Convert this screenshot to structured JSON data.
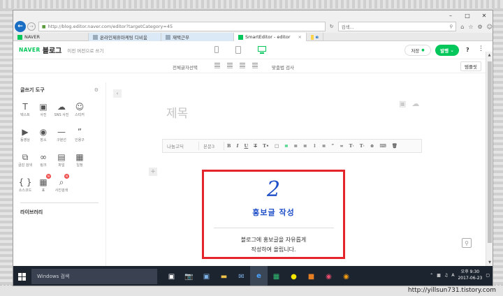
{
  "window": {
    "minimize_label": "–",
    "maximize_label": "□",
    "close_label": "✕"
  },
  "browser": {
    "url": "http://blog.editor.naver.com/editor?targetCategory=45",
    "search_placeholder": "검색...",
    "tabs": [
      {
        "label": "NAVER",
        "active": false
      },
      {
        "label": "온라인제휴마케팅 디비움",
        "active": false
      },
      {
        "label": "재택근무",
        "active": false
      },
      {
        "label": "SmartEditor - editor",
        "active": true
      },
      {
        "label": "",
        "active": false
      }
    ]
  },
  "header": {
    "naver_logo": "NAVER",
    "blog_label": "블로그",
    "prev_version": "이전 버전으로 쓰기",
    "save_label": "저장",
    "publish_label": "발행",
    "help_label": "?",
    "menu_label": "⋮"
  },
  "editor_toolbar": {
    "select_all": "전체글자선택",
    "spellcheck": "맞춤법 검사",
    "template": "템플릿"
  },
  "left_panel": {
    "title": "글쓰기 도구",
    "tools": [
      {
        "label": "텍스트",
        "icon": "text-icon",
        "glyph": "T",
        "badge": ""
      },
      {
        "label": "사진",
        "icon": "photo-icon",
        "glyph": "▣",
        "badge": ""
      },
      {
        "label": "SNS 사진",
        "icon": "cloud-icon",
        "glyph": "☁",
        "badge": ""
      },
      {
        "label": "스티커",
        "icon": "sticker-icon",
        "glyph": "☺",
        "badge": ""
      },
      {
        "label": "",
        "icon": "blank",
        "glyph": "",
        "badge": ""
      },
      {
        "label": "동영상",
        "icon": "video-icon",
        "glyph": "▶",
        "badge": ""
      },
      {
        "label": "장소",
        "icon": "place-icon",
        "glyph": "◉",
        "badge": ""
      },
      {
        "label": "구분선",
        "icon": "divider-icon",
        "glyph": "—",
        "badge": ""
      },
      {
        "label": "인용구",
        "icon": "quote-icon",
        "glyph": "”",
        "badge": ""
      },
      {
        "label": "",
        "icon": "blank",
        "glyph": "",
        "badge": ""
      },
      {
        "label": "글감 검색",
        "icon": "material-search-icon",
        "glyph": "⧉",
        "badge": ""
      },
      {
        "label": "링크",
        "icon": "link-icon",
        "glyph": "∞",
        "badge": ""
      },
      {
        "label": "파일",
        "icon": "file-icon",
        "glyph": "▤",
        "badge": ""
      },
      {
        "label": "일정",
        "icon": "calendar-icon",
        "glyph": "▦",
        "badge": ""
      },
      {
        "label": "",
        "icon": "blank",
        "glyph": "",
        "badge": ""
      },
      {
        "label": "소스코드",
        "icon": "code-icon",
        "glyph": "{ }",
        "badge": ""
      },
      {
        "label": "표",
        "icon": "table-icon",
        "glyph": "▦",
        "badge": "N"
      },
      {
        "label": "사진검색",
        "icon": "image-search-icon",
        "glyph": "⌕",
        "badge": "N"
      }
    ],
    "library_label": "라이브러리"
  },
  "editor": {
    "title_placeholder": "제목",
    "format_bar": {
      "font": "나눔고딕",
      "style": "본문3"
    }
  },
  "callout": {
    "number": "2",
    "title": "홍보글 작성",
    "desc_line1": "블로그에 홍보글을 자유롭게",
    "desc_line2": "작성하여 올립니다.",
    "border_color": "#e4262c",
    "text_color": "#1f4fc8"
  },
  "taskbar": {
    "search_label": "Windows 검색",
    "time_line1": "오후 9:30",
    "time_line2": "2017-06-23"
  },
  "watermark": "http://yillsun731.tistory.com"
}
